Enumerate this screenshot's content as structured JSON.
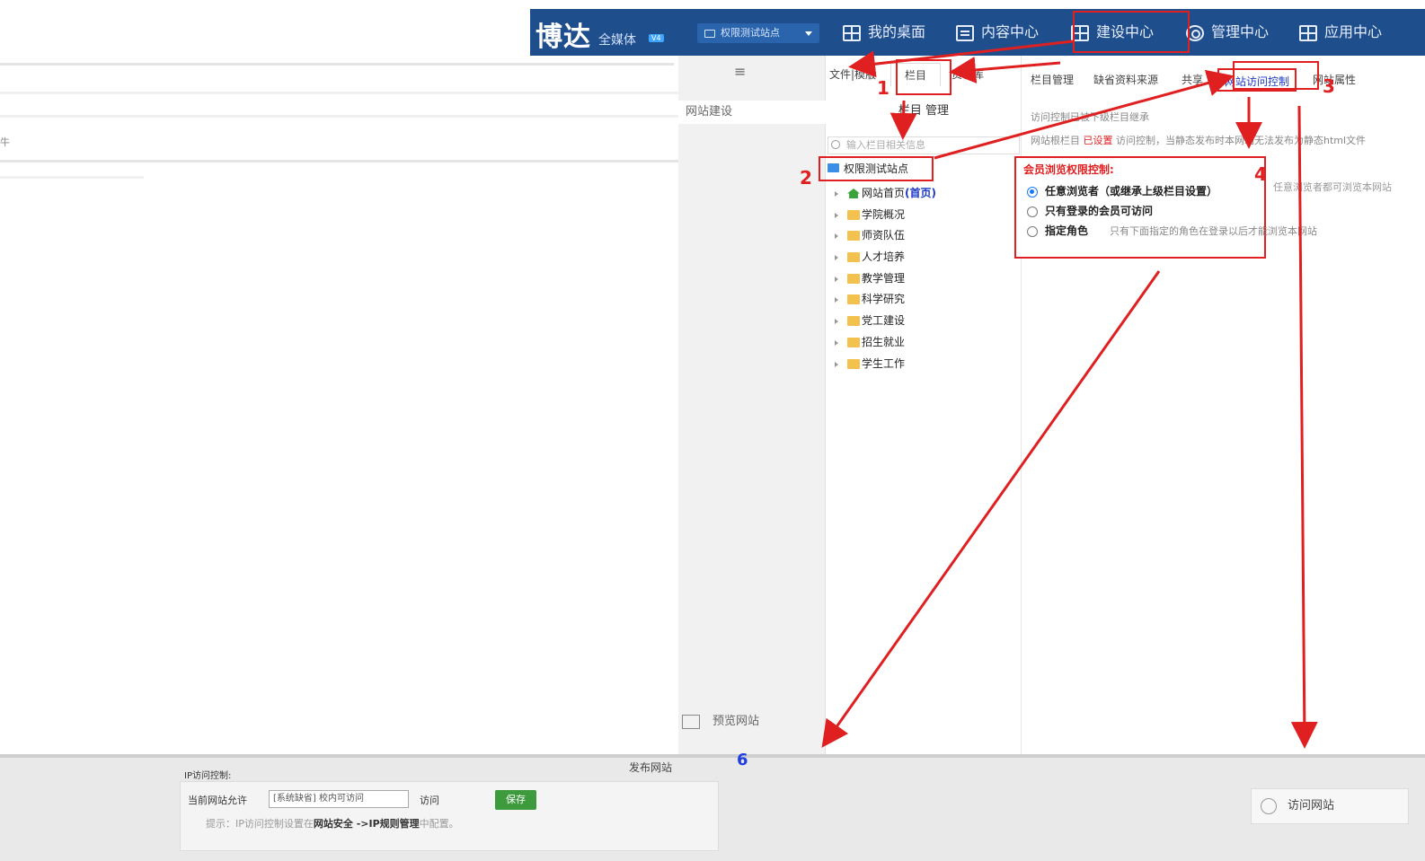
{
  "left_artifact": {
    "label": "牛"
  },
  "topbar": {
    "logo": "博达",
    "logo_sub": "全媒体",
    "logo_version": "V4",
    "site_selector": "权限测试站点",
    "nav": [
      {
        "label": "我的桌面",
        "icon": "grid-icon"
      },
      {
        "label": "内容中心",
        "icon": "list-icon"
      },
      {
        "label": "建设中心",
        "icon": "grid-icon"
      },
      {
        "label": "管理中心",
        "icon": "gear-icon"
      },
      {
        "label": "应用中心",
        "icon": "grid-icon"
      }
    ]
  },
  "navcol": {
    "collapse_icon": "≡",
    "site_build": "网站建设",
    "preview": "预览网站"
  },
  "tree": {
    "tabs": [
      "文件|模版",
      "栏目",
      "资料库"
    ],
    "header": "栏目 管理",
    "search_placeholder": "输入栏目相关信息",
    "root": "权限测试站点",
    "items": [
      {
        "label": "网站首页",
        "suffix": "(首页)",
        "home": true
      },
      {
        "label": "学院概况"
      },
      {
        "label": "师资队伍"
      },
      {
        "label": "人才培养"
      },
      {
        "label": "教学管理"
      },
      {
        "label": "科学研究"
      },
      {
        "label": "党工建设"
      },
      {
        "label": "招生就业"
      },
      {
        "label": "学生工作"
      }
    ]
  },
  "content": {
    "tabs": [
      "栏目管理",
      "缺省资料来源",
      "共享",
      "网站访问控制",
      "网站属性"
    ],
    "inherit_note": "访问控制已被下级栏目继承",
    "root_line_prefix": "网站根栏目",
    "root_line_status": "已设置",
    "root_line_suffix": "访问控制，当静态发布时本网站无法发布为静态html文件",
    "perm_title": "会员浏览权限控制:",
    "options": [
      {
        "label": "任意浏览者（或继承上级栏目设置）",
        "checked": true,
        "hint": ""
      },
      {
        "label": "只有登录的会员可访问",
        "checked": false,
        "hint": ""
      },
      {
        "label": "指定角色",
        "checked": false,
        "hint": "只有下面指定的角色在登录以后才能浏览本网站"
      }
    ],
    "side_hint": "任意浏览者都可浏览本网站"
  },
  "bottom": {
    "ip_label": "IP访问控制:",
    "current_label": "当前网站允许",
    "select_value": "[系统缺省] 校内可访问",
    "access": "访问",
    "save": "保存",
    "tip_prefix": "提示：IP访问控制设置在",
    "tip_bold": "网站安全 ->IP规则管理",
    "tip_suffix": "中配置。",
    "publish": "发布网站",
    "visit": "访问网站"
  },
  "annotations": [
    "1",
    "2",
    "3",
    "4",
    "6"
  ]
}
